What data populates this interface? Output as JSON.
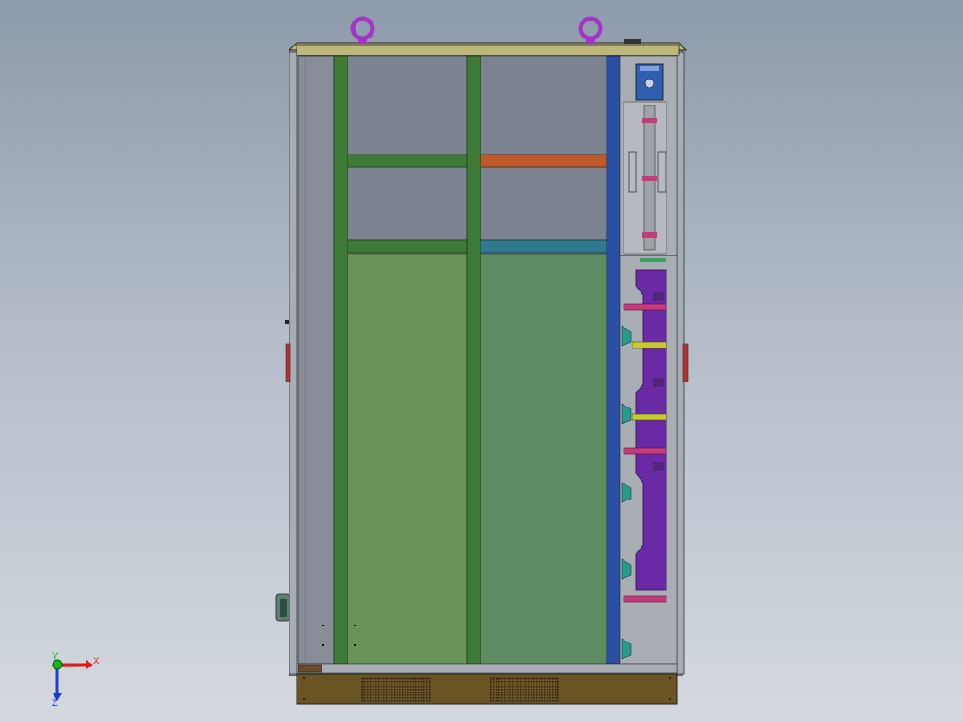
{
  "triad": {
    "x_label": "X",
    "y_label": "Y",
    "z_label": "Z",
    "colors": {
      "x": "#e01a1a",
      "y": "#14b814",
      "z": "#1b3fd6"
    }
  },
  "model": {
    "colors": {
      "frame_green": "#3d7a35",
      "panel_green_left": "#6a9358",
      "panel_green_right": "#5b8c62",
      "upper_gray": "#7b8290",
      "busbar_blue": "#2b4fa3",
      "purple": "#6a2aa6",
      "eyebolt": "#a334c8",
      "base_brown": "#6b5424",
      "top_olive": "#bdb779",
      "orange": "#c05a2a",
      "teal": "#2f7a8c",
      "magenta": "#c43a7a",
      "yellow": "#c8c830",
      "terminal_teal": "#2a9a8a"
    }
  }
}
